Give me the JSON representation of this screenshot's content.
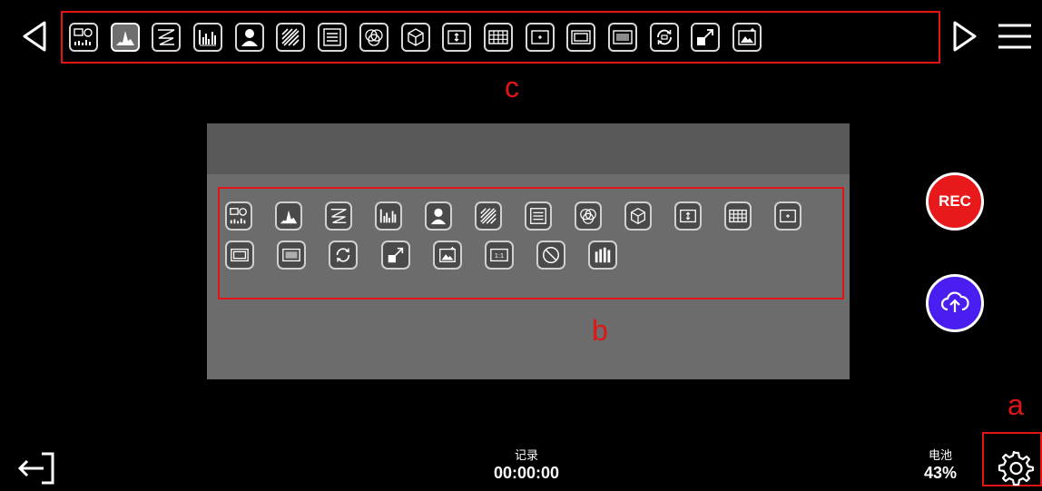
{
  "top_toolbar": {
    "tools": [
      {
        "icon": "multiview-icon"
      },
      {
        "icon": "histogram-icon",
        "selected": true
      },
      {
        "icon": "waveform-icon"
      },
      {
        "icon": "rgb-parade-icon"
      },
      {
        "icon": "false-color-icon"
      },
      {
        "icon": "zebra-icon"
      },
      {
        "icon": "scopes-lines-icon"
      },
      {
        "icon": "vectorscope-icon"
      },
      {
        "icon": "3d-lut-icon"
      },
      {
        "icon": "anamorphic-icon"
      },
      {
        "icon": "grid-overlay-icon"
      },
      {
        "icon": "center-marker-icon"
      },
      {
        "icon": "frame-guide-icon"
      },
      {
        "icon": "safe-area-icon"
      },
      {
        "icon": "rotate-image-icon"
      },
      {
        "icon": "scale-icon"
      },
      {
        "icon": "image-adjust-icon"
      }
    ]
  },
  "panel_tools": {
    "row1": [
      "multiview-icon",
      "histogram-icon",
      "waveform-icon",
      "rgb-parade-icon",
      "false-color-icon",
      "zebra-icon",
      "scopes-lines-icon",
      "vectorscope-icon",
      "3d-lut-icon",
      "anamorphic-icon",
      "grid-overlay-icon",
      "center-marker-icon"
    ],
    "row2": [
      "frame-guide-icon",
      "safe-area-icon",
      "rotate-image-icon",
      "scale-icon",
      "image-adjust-icon",
      "pixel-to-pixel-icon",
      "disable-icon",
      "audio-meter-icon"
    ],
    "pixel_label": "1:1"
  },
  "annotations": {
    "c": "c",
    "b": "b",
    "a": "a"
  },
  "rec_button": {
    "label": "REC",
    "color": "#e8191a"
  },
  "upload_button": {
    "color": "#4a1df0"
  },
  "status": {
    "record_label": "记录",
    "record_time": "00:00:00",
    "battery_label": "电池",
    "battery_value": "43%"
  }
}
